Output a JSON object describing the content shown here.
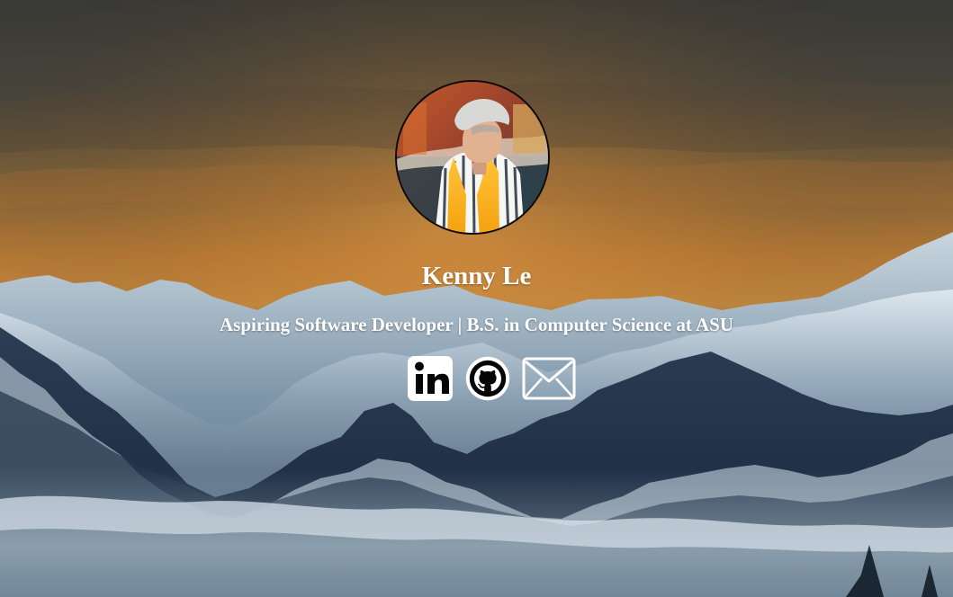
{
  "profile": {
    "name": "Kenny Le",
    "tagline": "Aspiring Software Developer | B.S. in Computer Science at ASU",
    "avatar_alt": "Kenny Le"
  },
  "social": [
    {
      "label": "LinkedIn",
      "icon": "linkedin-icon"
    },
    {
      "label": "GitHub",
      "icon": "github-icon"
    },
    {
      "label": "Email",
      "icon": "mail-icon"
    }
  ],
  "colors": {
    "text": "#ffffff",
    "sky_top": "#3d3d37",
    "sky_glow": "#c98a3a",
    "mountain_shadow": "#1e2d40",
    "snow": "#d7e1ea"
  }
}
